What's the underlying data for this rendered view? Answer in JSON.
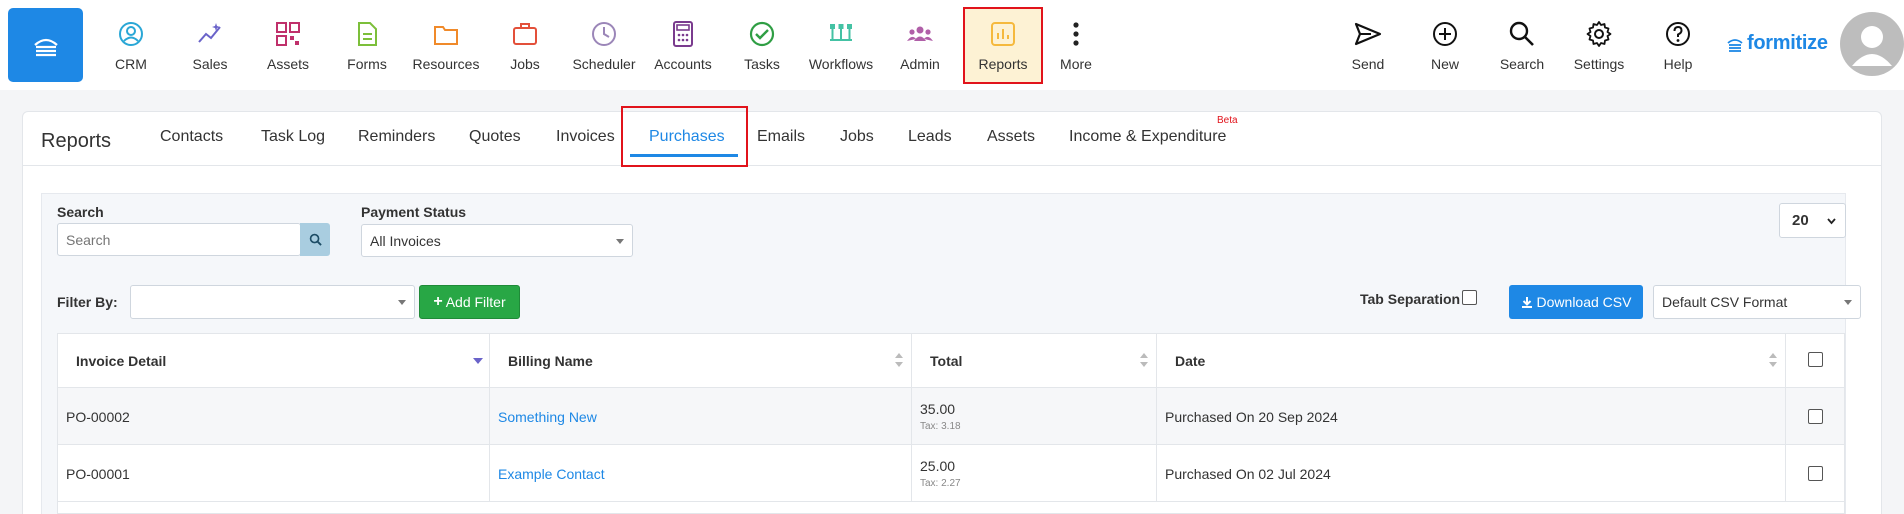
{
  "nav": {
    "items": [
      {
        "label": "CRM",
        "icon": "crm-icon"
      },
      {
        "label": "Sales",
        "icon": "sales-icon"
      },
      {
        "label": "Assets",
        "icon": "assets-icon"
      },
      {
        "label": "Forms",
        "icon": "forms-icon"
      },
      {
        "label": "Resources",
        "icon": "resources-icon"
      },
      {
        "label": "Jobs",
        "icon": "jobs-icon"
      },
      {
        "label": "Scheduler",
        "icon": "scheduler-icon"
      },
      {
        "label": "Accounts",
        "icon": "accounts-icon"
      },
      {
        "label": "Tasks",
        "icon": "tasks-icon"
      },
      {
        "label": "Workflows",
        "icon": "workflows-icon"
      },
      {
        "label": "Admin",
        "icon": "admin-icon"
      },
      {
        "label": "Reports",
        "icon": "reports-icon"
      },
      {
        "label": "More",
        "icon": "more-icon"
      }
    ],
    "right": [
      {
        "label": "Send",
        "icon": "send-icon"
      },
      {
        "label": "New",
        "icon": "new-icon"
      },
      {
        "label": "Search",
        "icon": "search-icon"
      },
      {
        "label": "Settings",
        "icon": "settings-icon"
      },
      {
        "label": "Help",
        "icon": "help-icon"
      }
    ],
    "brand": "formitize",
    "active": "Reports"
  },
  "report": {
    "title": "Reports",
    "tabs": [
      "Contacts",
      "Task Log",
      "Reminders",
      "Quotes",
      "Invoices",
      "Purchases",
      "Emails",
      "Jobs",
      "Leads",
      "Assets",
      "Income & Expenditure"
    ],
    "active_tab": "Purchases",
    "beta_label": "Beta"
  },
  "filters": {
    "search_label": "Search",
    "search_placeholder": "Search",
    "payment_status_label": "Payment Status",
    "payment_status_value": "All Invoices",
    "page_size": "20",
    "filter_by_label": "Filter By:",
    "add_filter_label": "Add Filter",
    "tab_separation_label": "Tab Separation",
    "download_csv_label": "Download CSV",
    "csv_format_value": "Default CSV Format"
  },
  "table": {
    "columns": [
      "Invoice Detail",
      "Billing Name",
      "Total",
      "Date"
    ],
    "rows": [
      {
        "invoice": "PO-00002",
        "billing_name": "Something New",
        "total": "35.00",
        "tax": "Tax: 3.18",
        "date": "Purchased On 20 Sep 2024"
      },
      {
        "invoice": "PO-00001",
        "billing_name": "Example Contact",
        "total": "25.00",
        "tax": "Tax: 2.27",
        "date": "Purchased On 02 Jul 2024"
      }
    ]
  },
  "colors": {
    "accent": "#1e88e5",
    "success": "#28a745",
    "highlight": "#e1131b",
    "active_nav_bg": "#fdf2d4"
  }
}
